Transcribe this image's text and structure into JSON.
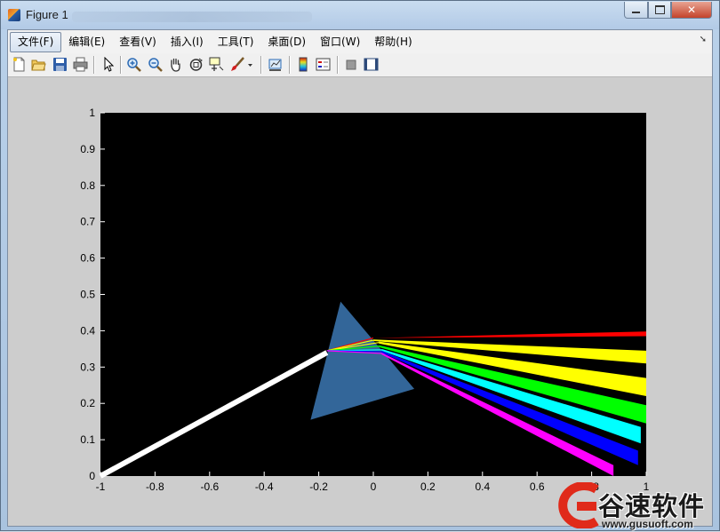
{
  "window": {
    "title": "Figure 1"
  },
  "menu": {
    "items": [
      {
        "label": "文件(F)"
      },
      {
        "label": "编辑(E)"
      },
      {
        "label": "查看(V)"
      },
      {
        "label": "插入(I)"
      },
      {
        "label": "工具(T)"
      },
      {
        "label": "桌面(D)"
      },
      {
        "label": "窗口(W)"
      },
      {
        "label": "帮助(H)"
      }
    ]
  },
  "toolbar": {
    "icons": [
      "new-figure-icon",
      "open-icon",
      "save-icon",
      "print-icon",
      "edit-plot-arrow-icon",
      "zoom-in-icon",
      "zoom-out-icon",
      "pan-hand-icon",
      "rotate-3d-icon",
      "data-cursor-icon",
      "brush-icon",
      "brush-dropdown-icon",
      "link-plot-icon",
      "colorbar-icon",
      "legend-icon",
      "hide-plot-tools-icon",
      "show-plot-tools-icon"
    ]
  },
  "colors": {
    "axes_background": "#000000",
    "figure_background": "#cdcdcd",
    "prism": "#336699",
    "incident_beam": "#ffffff"
  },
  "chart_data": {
    "type": "line",
    "xlim": [
      -1,
      1
    ],
    "ylim": [
      0,
      1
    ],
    "xticks": [
      "-1",
      "-0.8",
      "-0.6",
      "-0.4",
      "-0.2",
      "0",
      "0.2",
      "0.4",
      "0.6",
      "0.8",
      "1"
    ],
    "xtick_values": [
      -1,
      -0.8,
      -0.6,
      -0.4,
      -0.2,
      0,
      0.2,
      0.4,
      0.6,
      0.8,
      1
    ],
    "yticks": [
      "0",
      "0.1",
      "0.2",
      "0.3",
      "0.4",
      "0.5",
      "0.6",
      "0.7",
      "0.8",
      "0.9",
      "1"
    ],
    "ytick_values": [
      0,
      0.1,
      0.2,
      0.3,
      0.4,
      0.5,
      0.6,
      0.7,
      0.8,
      0.9,
      1
    ],
    "grid": false,
    "prism": {
      "x": [
        -0.12,
        0.15,
        -0.23
      ],
      "y": [
        0.48,
        0.24,
        0.155
      ]
    },
    "incident_beam": {
      "x": [
        -1,
        -0.17
      ],
      "y": [
        0,
        0.34
      ]
    },
    "internal_rays": {
      "x0": -0.17,
      "y0": 0.345,
      "x1": 0.0,
      "y1": 0.36
    },
    "exit_rays": [
      {
        "name": "red",
        "color": "#ff0000",
        "x": [
          0.0,
          1.0
        ],
        "y0": [
          0.38,
          0.385
        ],
        "y1": [
          0.38,
          0.398
        ]
      },
      {
        "name": "yellow",
        "color": "#ffff00",
        "x": [
          0.0,
          1.0
        ],
        "y0": [
          0.372,
          0.31
        ],
        "y1": [
          0.376,
          0.345
        ]
      },
      {
        "name": "yellow",
        "color": "#ffff00",
        "x": [
          0.02,
          1.0
        ],
        "y0": [
          0.365,
          0.22
        ],
        "y1": [
          0.37,
          0.27
        ]
      },
      {
        "name": "green",
        "color": "#00ff00",
        "x": [
          0.02,
          1.0
        ],
        "y0": [
          0.355,
          0.145
        ],
        "y1": [
          0.36,
          0.195
        ]
      },
      {
        "name": "cyan",
        "color": "#00ffff",
        "x": [
          0.03,
          0.98
        ],
        "y0": [
          0.345,
          0.09
        ],
        "y1": [
          0.35,
          0.135
        ]
      },
      {
        "name": "blue",
        "color": "#0000ff",
        "x": [
          0.03,
          0.97
        ],
        "y0": [
          0.34,
          0.03
        ],
        "y1": [
          0.345,
          0.07
        ]
      },
      {
        "name": "magenta",
        "color": "#ff00ff",
        "x": [
          0.03,
          0.88
        ],
        "y0": [
          0.335,
          0.0
        ],
        "y1": [
          0.34,
          0.03
        ]
      }
    ]
  },
  "watermark": {
    "brand": "谷速软件",
    "url": "www.gusuoft.com"
  }
}
